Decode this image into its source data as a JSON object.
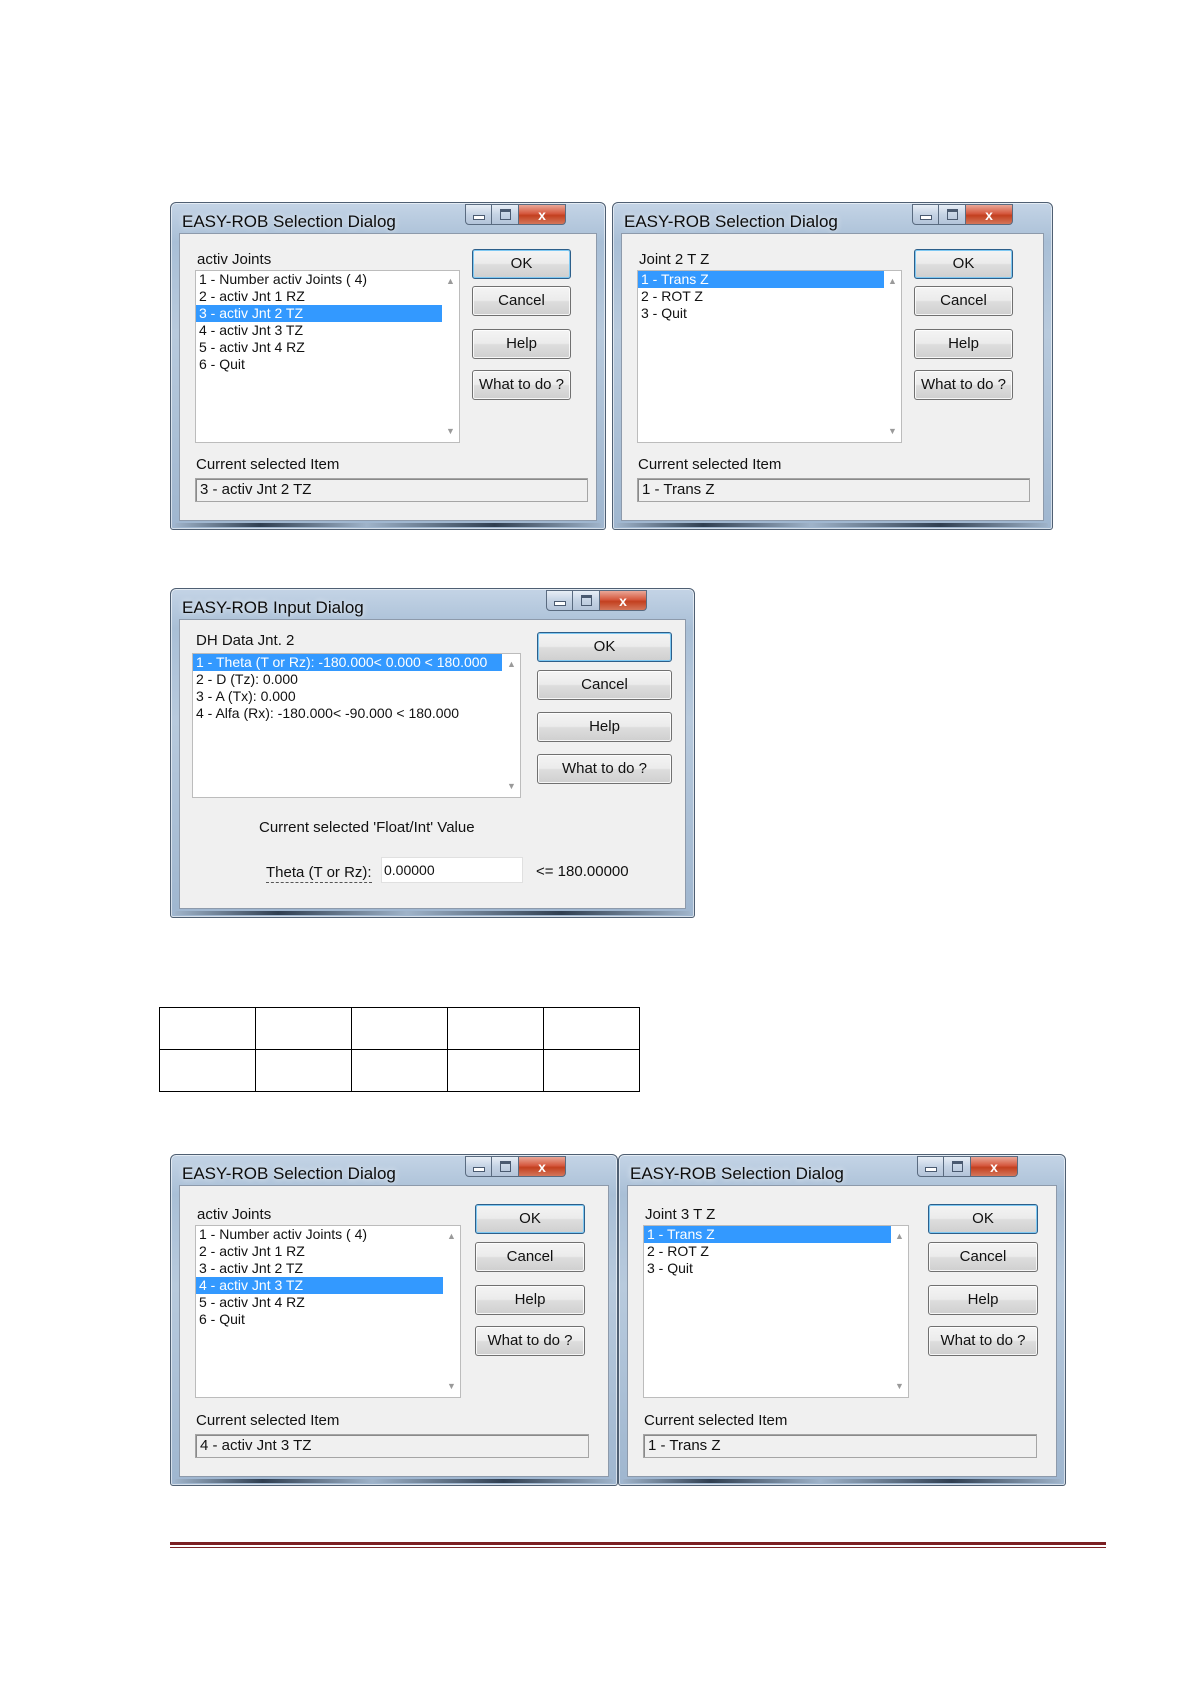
{
  "window_controls": {
    "close_glyph": "x"
  },
  "dialog1": {
    "title": "EASY-ROB Selection Dialog",
    "list_label": "activ Joints",
    "items": [
      "1 - Number activ Joints ( 4)",
      "2 - activ Jnt  1 RZ",
      "3 - activ Jnt  2 TZ",
      "4 - activ Jnt  3 TZ",
      "5 - activ Jnt  4 RZ",
      "6 - Quit"
    ],
    "selected_index": 2,
    "current_label": "Current selected Item",
    "current_value": "3 - activ Jnt  2 TZ",
    "buttons": {
      "ok": "OK",
      "cancel": "Cancel",
      "help": "Help",
      "what": "What to do ?"
    }
  },
  "dialog2": {
    "title": "EASY-ROB Selection Dialog",
    "list_label": "Joint  2 T Z",
    "items": [
      "1 - Trans Z",
      "2 - ROT Z",
      "3 - Quit"
    ],
    "selected_index": 0,
    "current_label": "Current selected Item",
    "current_value": "1 - Trans Z",
    "buttons": {
      "ok": "OK",
      "cancel": "Cancel",
      "help": "Help",
      "what": "What to do ?"
    }
  },
  "dialog3": {
    "title": "EASY-ROB Input Dialog",
    "list_label": "DH Data Jnt. 2",
    "items": [
      "1 - Theta (T or Rz): -180.000<    0.000 < 180.000",
      "2 - D (Tz):    0.000",
      "3 - A (Tx):    0.000",
      "4 - Alfa (Rx): -180.000<  -90.000 < 180.000"
    ],
    "selected_index": 0,
    "value_caption": "Current selected 'Float/Int' Value",
    "field_label": "Theta (T or Rz):",
    "field_value": "0.00000",
    "upper_bound": "<=  180.00000",
    "buttons": {
      "ok": "OK",
      "cancel": "Cancel",
      "help": "Help",
      "what": "What to do ?"
    }
  },
  "dialog4": {
    "title": "EASY-ROB Selection Dialog",
    "list_label": "activ Joints",
    "items": [
      "1 - Number activ Joints ( 4)",
      "2 - activ Jnt  1 RZ",
      "3 - activ Jnt  2 TZ",
      "4 - activ Jnt  3 TZ",
      "5 - activ Jnt  4 RZ",
      "6 - Quit"
    ],
    "selected_index": 3,
    "current_label": "Current selected Item",
    "current_value": "4 - activ Jnt  3 TZ",
    "buttons": {
      "ok": "OK",
      "cancel": "Cancel",
      "help": "Help",
      "what": "What to do ?"
    }
  },
  "dialog5": {
    "title": "EASY-ROB Selection Dialog",
    "list_label": "Joint  3 T Z",
    "items": [
      "1 - Trans Z",
      "2 - ROT Z",
      "3 - Quit"
    ],
    "selected_index": 0,
    "current_label": "Current selected Item",
    "current_value": "1 - Trans Z",
    "buttons": {
      "ok": "OK",
      "cancel": "Cancel",
      "help": "Help",
      "what": "What to do ?"
    }
  },
  "doc_table": {
    "rows": [
      [
        "",
        "",
        "",
        "",
        ""
      ],
      [
        "",
        "",
        "",
        "",
        ""
      ]
    ]
  }
}
